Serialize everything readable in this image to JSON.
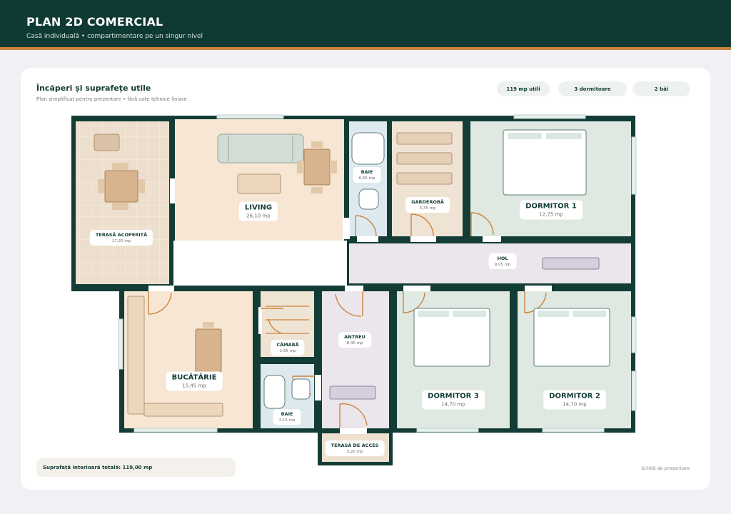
{
  "header": {
    "title": "PLAN 2D COMERCIAL",
    "subtitle": "Casă individuală • compartimentare pe un singur nivel"
  },
  "section": {
    "title": "Încăperi și suprafețe utile",
    "subtitle": "Plan simplificat pentru prezentare • fără cote tehnice liniare"
  },
  "badges": [
    "119 mp utili",
    "3 dormitoare",
    "2 băi"
  ],
  "rooms": {
    "terasa_acoperita": {
      "name": "TERASĂ ACOPERITĂ",
      "area": "17,20 mp"
    },
    "living": {
      "name": "LIVING",
      "area": "26,10 mp"
    },
    "baie_1": {
      "name": "BAIE",
      "area": "6,65 mp"
    },
    "garderoba": {
      "name": "GARDEROBĂ",
      "area": "5,35 mp"
    },
    "dormitor_1": {
      "name": "DORMITOR 1",
      "area": "12,75 mp"
    },
    "hol": {
      "name": "HOL",
      "area": "9,05 mp"
    },
    "bucatarie": {
      "name": "BUCĂTĂRIE",
      "area": "15,45 mp"
    },
    "camara": {
      "name": "CĂMARĂ",
      "area": "2,65 mp"
    },
    "baie_2": {
      "name": "BAIE",
      "area": "3,15 mp"
    },
    "antreu": {
      "name": "ANTREU",
      "area": "8,45 mp"
    },
    "dormitor_3": {
      "name": "DORMITOR 3",
      "area": "14,70 mp"
    },
    "dormitor_2": {
      "name": "DORMITOR 2",
      "area": "14,70 mp"
    },
    "terasa_acces": {
      "name": "TERASĂ DE ACCES",
      "area": "3,20 mp"
    }
  },
  "footer": {
    "total": "Suprafață interioară totală: 119,00 mp",
    "note": "Schiță de prezentare"
  },
  "colors": {
    "wall": "#123c35",
    "accent": "#c9853f",
    "bedroom_floor": "#dfe9e1",
    "living_floor": "#f6e6d3",
    "terrace_floor": "#ede0cf",
    "bath_floor": "#dde9ef",
    "hall_floor": "#ebe5ec"
  }
}
